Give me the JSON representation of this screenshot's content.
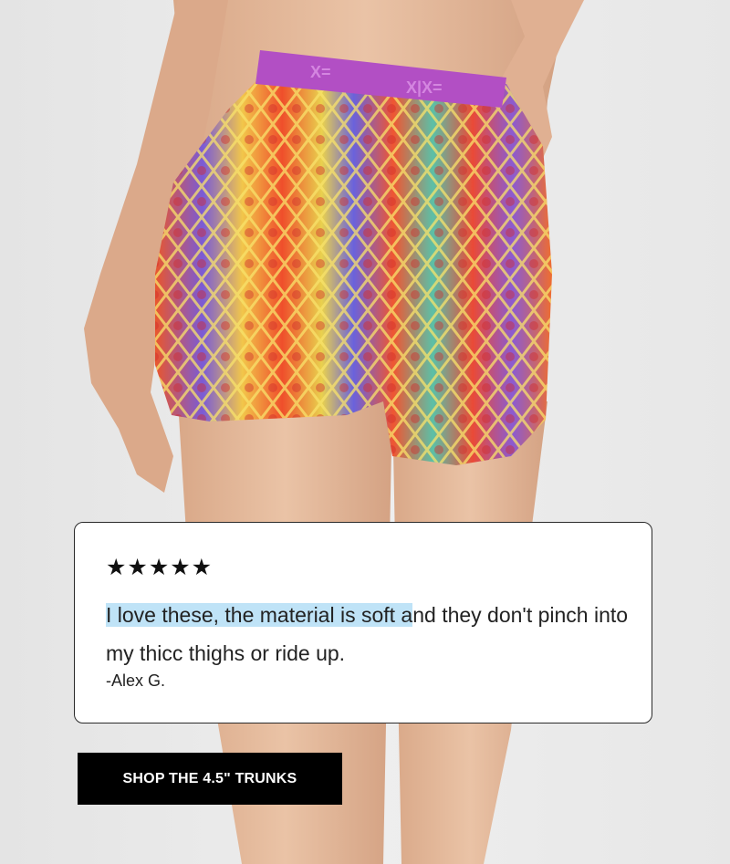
{
  "brand": {
    "waistband_logo": "X="
  },
  "review": {
    "stars": "★★★★★",
    "rating": 5,
    "quote_highlighted": "I love these, the material is soft a",
    "quote_rest": "nd they don't pinch into my thicc thighs or ride up.",
    "author": "-Alex G."
  },
  "cta": {
    "label": "SHOP THE 4.5\" TRUNKS"
  },
  "colors": {
    "background": "#e9e9e9",
    "highlight": "#bfe3f7",
    "waistband": "#b24fc4",
    "button_bg": "#000000"
  }
}
